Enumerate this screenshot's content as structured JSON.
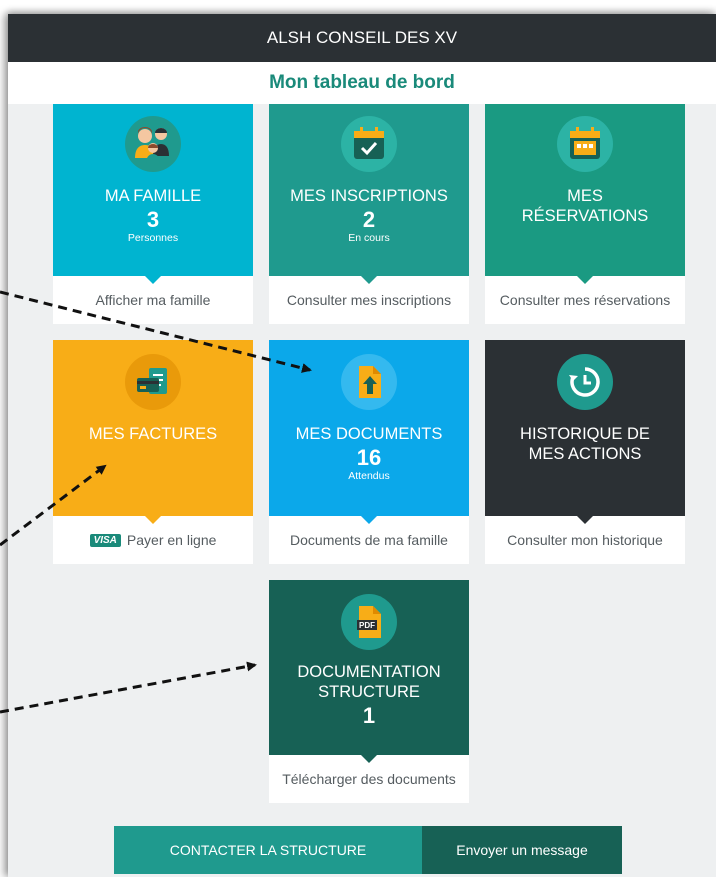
{
  "header": {
    "app_title": "ALSH CONSEIL DES XV",
    "page_title": "Mon tableau de bord"
  },
  "tiles": {
    "famille": {
      "label": "MA FAMILLE",
      "count": "3",
      "sub": "Personnes",
      "link": "Afficher ma famille",
      "icon": "family-icon",
      "color": "#00b4d0"
    },
    "inscriptions": {
      "label": "MES INSCRIPTIONS",
      "count": "2",
      "sub": "En cours",
      "link": "Consulter mes inscriptions",
      "icon": "calendar-check-icon",
      "color": "#1f9a8e"
    },
    "reservations": {
      "label_line1": "MES",
      "label_line2": "RÉSERVATIONS",
      "link": "Consulter mes réservations",
      "icon": "calendar-icon",
      "color": "#1a9a82"
    },
    "factures": {
      "label": "MES FACTURES",
      "link": "Payer en ligne",
      "badge": "VISA",
      "icon": "invoice-icon",
      "color": "#f8ad17"
    },
    "documents": {
      "label": "MES DOCUMENTS",
      "count": "16",
      "sub": "Attendus",
      "link": "Documents de ma famille",
      "icon": "upload-document-icon",
      "color": "#0ba8ea"
    },
    "historique": {
      "label_line1": "HISTORIQUE DE",
      "label_line2": "MES ACTIONS",
      "link": "Consulter mon historique",
      "icon": "history-icon",
      "color": "#2b3034"
    },
    "documentation": {
      "label_line1": "DOCUMENTATION",
      "label_line2": "STRUCTURE",
      "count": "1",
      "link": "Télécharger des documents",
      "icon": "pdf-icon",
      "pdf_text": "PDF",
      "color": "#176155"
    }
  },
  "contact": {
    "main_label": "CONTACTER LA STRUCTURE",
    "send_label": "Envoyer un message"
  }
}
